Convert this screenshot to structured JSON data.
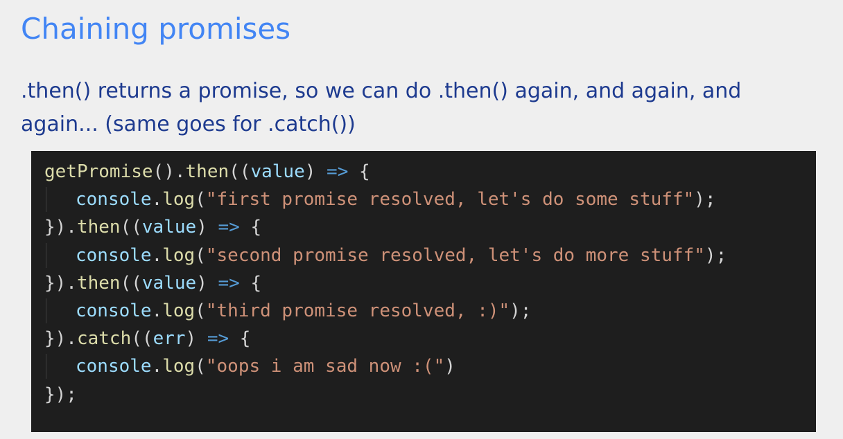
{
  "slide": {
    "title": "Chaining promises",
    "body": ".then() returns a promise, so we can do .then() again, and again, and again... (same goes for .catch())"
  },
  "code": {
    "line1": {
      "fn": "getPromise",
      "a": "().",
      "then": "then",
      "b": "((",
      "param": "value",
      "c": ") ",
      "arrow": "=>",
      "d": " {"
    },
    "line2": {
      "obj": "console",
      "a": ".",
      "fn": "log",
      "b": "(",
      "str": "\"first promise resolved, let's do some stuff\"",
      "c": ");"
    },
    "line3": {
      "a": "}).",
      "then": "then",
      "b": "((",
      "param": "value",
      "c": ") ",
      "arrow": "=>",
      "d": " {"
    },
    "line4": {
      "obj": "console",
      "a": ".",
      "fn": "log",
      "b": "(",
      "str": "\"second promise resolved, let's do more stuff\"",
      "c": ");"
    },
    "line5": {
      "a": "}).",
      "then": "then",
      "b": "((",
      "param": "value",
      "c": ") ",
      "arrow": "=>",
      "d": " {"
    },
    "line6": {
      "obj": "console",
      "a": ".",
      "fn": "log",
      "b": "(",
      "str": "\"third promise resolved, :)\"",
      "c": ");"
    },
    "line7": {
      "a": "}).",
      "catch": "catch",
      "b": "((",
      "param": "err",
      "c": ") ",
      "arrow": "=>",
      "d": " {"
    },
    "line8": {
      "obj": "console",
      "a": ".",
      "fn": "log",
      "b": "(",
      "str": "\"oops i am sad now :(\"",
      "c": ")"
    },
    "line9": {
      "a": "});"
    }
  },
  "colors": {
    "title": "#4285f4",
    "body_text": "#1d3a8f",
    "slide_background": "#efefef",
    "code_background": "#1e1e1e",
    "function": "#dcdcaa",
    "parameter": "#9cdcfe",
    "arrow": "#569cd6",
    "string": "#ce9178",
    "punctuation": "#d4d4d4"
  }
}
